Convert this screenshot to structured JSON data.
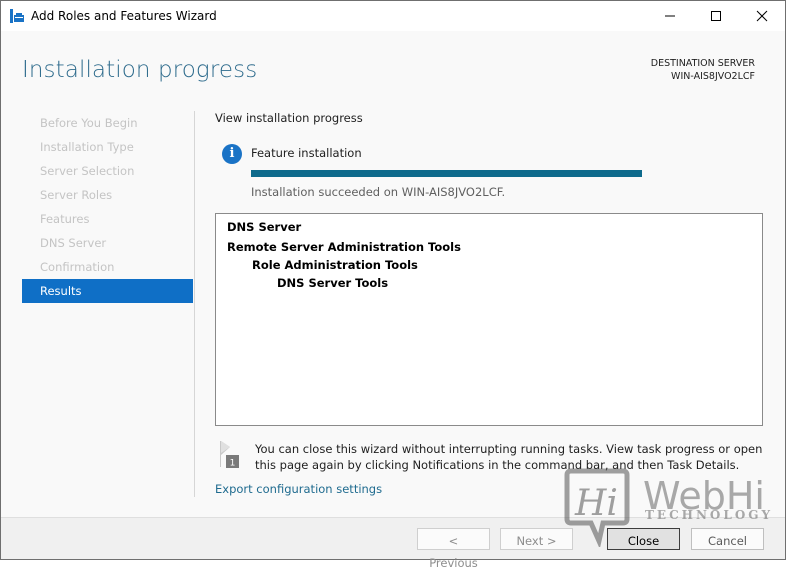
{
  "window": {
    "title": "Add Roles and Features Wizard",
    "controls": {
      "minimize": "—",
      "maximize": "☐",
      "close": "✕"
    }
  },
  "header": {
    "page_title": "Installation progress",
    "destination_label": "DESTINATION SERVER",
    "destination_server": "WIN-AIS8JVO2LCF"
  },
  "sidebar": {
    "items": [
      {
        "label": "Before You Begin",
        "active": false
      },
      {
        "label": "Installation Type",
        "active": false
      },
      {
        "label": "Server Selection",
        "active": false
      },
      {
        "label": "Server Roles",
        "active": false
      },
      {
        "label": "Features",
        "active": false
      },
      {
        "label": "DNS Server",
        "active": false
      },
      {
        "label": "Confirmation",
        "active": false
      },
      {
        "label": "Results",
        "active": true
      }
    ]
  },
  "main": {
    "section_label": "View installation progress",
    "feature_label": "Feature installation",
    "progress_percent": 100,
    "status_text": "Installation succeeded on WIN-AIS8JVO2LCF.",
    "results": [
      {
        "text": "DNS Server",
        "level": 0
      },
      {
        "text": "Remote Server Administration Tools",
        "level": 0
      },
      {
        "text": "Role Administration Tools",
        "level": 1
      },
      {
        "text": "DNS Server Tools",
        "level": 2
      }
    ],
    "notice_badge": "1",
    "notice_text": "You can close this wizard without interrupting running tasks. View task progress or open this page again by clicking Notifications in the command bar, and then Task Details.",
    "export_link": "Export configuration settings"
  },
  "footer": {
    "previous_label": "< Previous",
    "next_label": "Next >",
    "close_label": "Close",
    "cancel_label": "Cancel"
  },
  "watermark": {
    "logo_text": "Hi",
    "brand": "WebHi",
    "tagline": "TECHNOLOGY"
  },
  "colors": {
    "accent": "#0f6fc6",
    "progress": "#0e6a8c",
    "title": "#2f6c8d",
    "link": "#1f6b8f"
  }
}
